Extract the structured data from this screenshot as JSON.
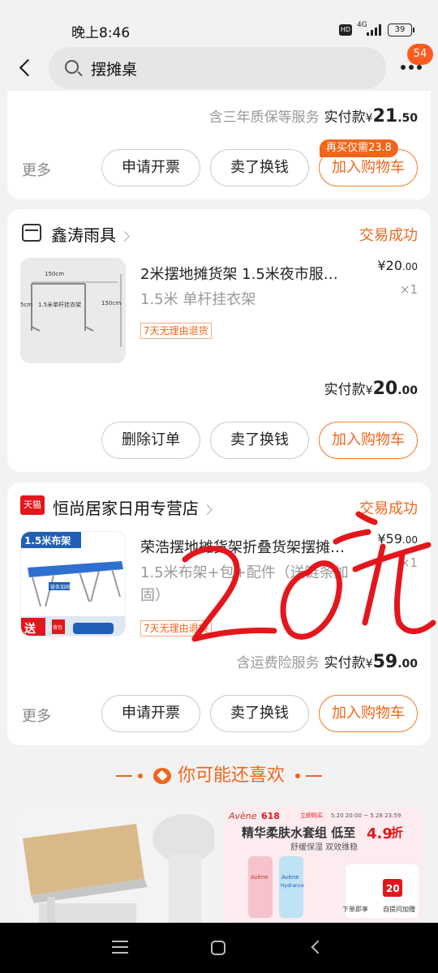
{
  "status_bar": {
    "time": "晚上8:46",
    "network_label": "4G",
    "hd_label": "HD",
    "battery": "39"
  },
  "search": {
    "query": "摆摊桌",
    "notification_count": "54"
  },
  "order1": {
    "service_text": "含三年质保等服务",
    "paid_label": "实付款",
    "paid_currency": "¥",
    "paid_int": "21",
    "paid_dec": ".50",
    "more_label": "更多",
    "promo_tag": "再买仅需23.8",
    "btn_invoice": "申请开票",
    "btn_resell": "卖了换钱",
    "btn_add_cart": "加入购物车"
  },
  "order2": {
    "shop_name": "鑫涛雨具",
    "status": "交易成功",
    "product_title": "2米摆地摊货架 1.5米夜市服…",
    "product_spec": "1.5米 单杆挂衣架",
    "tag": "7天无理由退货",
    "price_currency": "¥",
    "price_int": "20",
    "price_dec": ".00",
    "qty": "×1",
    "paid_label": "实付款",
    "paid_currency": "¥",
    "paid_int": "20",
    "paid_dec": ".00",
    "btn_delete": "删除订单",
    "btn_resell": "卖了换钱",
    "btn_add_cart": "加入购物车",
    "thumb_labels": [
      "150cm",
      "150cm",
      "5cm",
      "1.5米单杆挂衣架"
    ]
  },
  "order3": {
    "shop_badge": "天猫",
    "shop_name": "恒尚居家日用专营店",
    "status": "交易成功",
    "product_title": "荣浩摆地摊货架折叠货架摆摊…",
    "product_spec": "1.5米布架+包+配件（送链条加固）",
    "tag": "7天无理由退换",
    "price_currency": "¥",
    "price_int": "59",
    "price_dec": ".00",
    "qty": "×1",
    "service_text": "含运费险服务",
    "paid_label": "实付款",
    "paid_currency": "¥",
    "paid_int": "59",
    "paid_dec": ".00",
    "more_label": "更多",
    "btn_invoice": "申请开票",
    "btn_resell": "卖了换钱",
    "btn_add_cart": "加入购物车",
    "thumb_labels": [
      "1.5米布架",
      "链条加固",
      "送",
      "背包"
    ]
  },
  "recommend": {
    "title": "你可能还喜欢",
    "ad": {
      "brand": "Avène",
      "campaign": "618",
      "line1": "立即购买",
      "time_window": "5.20 20:00 ~ 5.28 23:59",
      "headline": "精华柔肤水套组 低至",
      "price": "4.9",
      "price_unit": "折",
      "subline": "舒缓保湿 双效维稳",
      "bottle_label_a": "Avène",
      "bottle_label_b": "Avène",
      "bottle_sub_b": "Hydrance",
      "coupon_amount": "20",
      "footer_a": "下单即享",
      "footer_b": "自提问加赠"
    }
  },
  "colors": {
    "accent": "#f0661b",
    "handwriting": "#e4161c",
    "tmall": "#e4161c"
  }
}
